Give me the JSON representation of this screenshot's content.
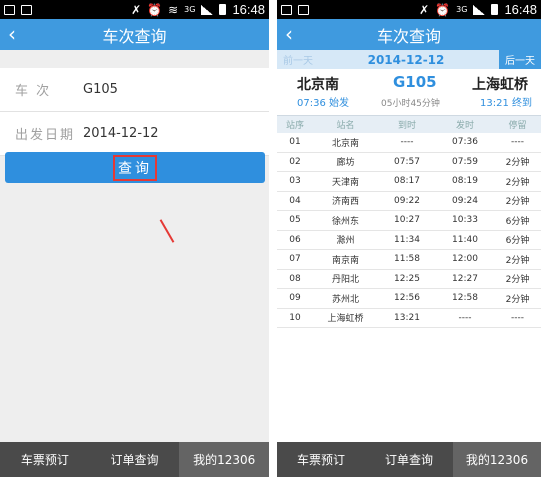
{
  "status_bar": {
    "time": "16:48",
    "network": "3G"
  },
  "left_screen": {
    "title": "车次查询",
    "back_glyph": "‹",
    "form": {
      "train_label": "车 次",
      "train_value": "G105",
      "date_label": "出发日期",
      "date_value": "2014-12-12"
    },
    "query_button": "查询"
  },
  "right_screen": {
    "title": "车次查询",
    "back_glyph": "‹",
    "prev_day": "前一天",
    "date": "2014-12-12",
    "next_day": "后一天",
    "route": {
      "from_station": "北京南",
      "from_time": "07:36 始发",
      "train": "G105",
      "duration": "05小时45分钟",
      "to_station": "上海虹桥",
      "to_time": "13:21 终到"
    },
    "table": {
      "headers": [
        "站序",
        "站名",
        "到时",
        "发时",
        "停留"
      ],
      "rows": [
        [
          "01",
          "北京南",
          "----",
          "07:36",
          "----"
        ],
        [
          "02",
          "廊坊",
          "07:57",
          "07:59",
          "2分钟"
        ],
        [
          "03",
          "天津南",
          "08:17",
          "08:19",
          "2分钟"
        ],
        [
          "04",
          "济南西",
          "09:22",
          "09:24",
          "2分钟"
        ],
        [
          "05",
          "徐州东",
          "10:27",
          "10:33",
          "6分钟"
        ],
        [
          "06",
          "滁州",
          "11:34",
          "11:40",
          "6分钟"
        ],
        [
          "07",
          "南京南",
          "11:58",
          "12:00",
          "2分钟"
        ],
        [
          "08",
          "丹阳北",
          "12:25",
          "12:27",
          "2分钟"
        ],
        [
          "09",
          "苏州北",
          "12:56",
          "12:58",
          "2分钟"
        ],
        [
          "10",
          "上海虹桥",
          "13:21",
          "----",
          "----"
        ]
      ]
    }
  },
  "tab_bar": {
    "tabs": [
      "车票预订",
      "订单查询",
      "我的12306"
    ]
  }
}
